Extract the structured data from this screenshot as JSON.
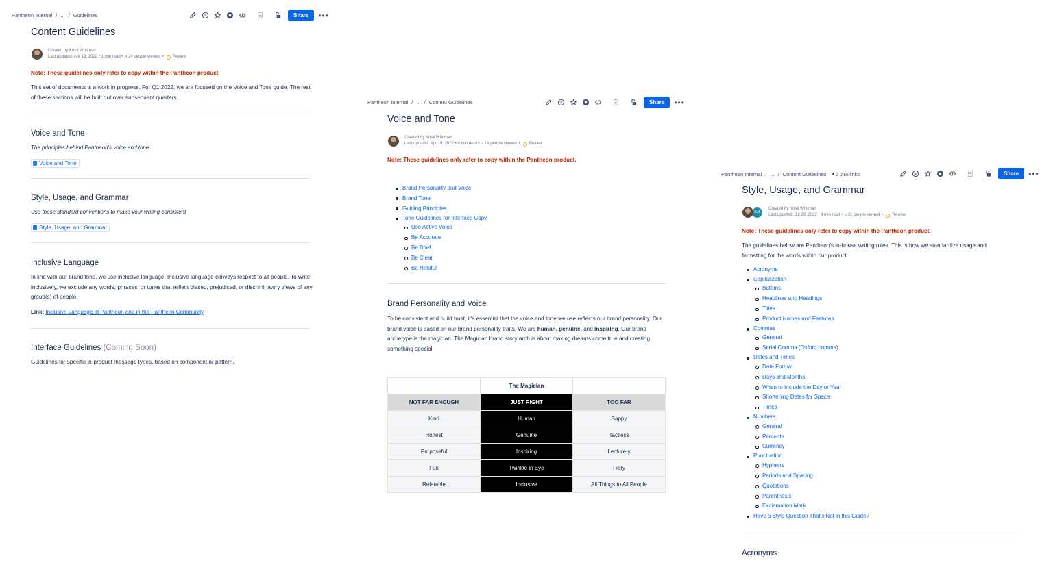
{
  "common": {
    "space": "Pantheon Internal",
    "ellipsis": "...",
    "slash": "/",
    "share": "Share",
    "dots": "•••",
    "created_prefix": "Created by",
    "author": "Kristi Whitman",
    "review": "Review",
    "note": "Note: These guidelines only refer to copy within the Pantheon product."
  },
  "panel1": {
    "crumb": "Guidelines",
    "title": "Content Guidelines",
    "meta": "Last updated: Apr 19, 2022 •  1 min read  •  ",
    "views": "24 people viewed",
    "intro": "This set of documents is a work in progress. For Q1 2022, we are focused on the Voice and Tone guide. The rest of these sections will be built out over subsequent quarters.",
    "sections": [
      {
        "heading": "Voice and Tone",
        "desc": "The principles behind Pantheon's voice and tone",
        "link": "Voice and Tone"
      },
      {
        "heading": "Style, Usage, and Grammar",
        "desc": "Use these standard conventions to make your writing consistent",
        "link": "Style, Usage, and Grammar"
      }
    ],
    "inclusive": {
      "heading": "Inclusive Language",
      "body": "In line with our brand tone, we use inclusive language. Inclusive language conveys respect to all people. To write inclusively, we exclude any words, phrases, or tones that reflect biased, prejudiced, or discriminatory views of any group(s) of people.",
      "link_label": "Link:",
      "link_text": "Inclusive Language at Pantheon and in the Pantheon Community"
    },
    "interface": {
      "heading": "Interface Guidelines",
      "soon": "(Coming Soon)",
      "body": "Guidelines for specific in-product message types, based on component or pattern."
    }
  },
  "panel2": {
    "crumb": "Content Guidelines",
    "title": "Voice and Tone",
    "meta": "Last updated: Apr 19, 2022 •  4 min read  •  ",
    "views": "19 people viewed",
    "toc": [
      "Brand Personality and Voice",
      "Brand Tone",
      "Guiding Principles",
      "Tone Guidelines for Interface Copy",
      "Use Active Voice",
      "Be Accurate",
      "Be Brief",
      "Be Clear",
      "Be Helpful"
    ],
    "section_heading": "Brand Personality and Voice",
    "body_a": "To be consistent and build trust, it's essential that the voice and tone we use reflects our brand personality. Our brand voice is based on our brand personality traits. We are ",
    "body_b1": "human, genuine,",
    "body_and": " and ",
    "body_b2": "inspiring",
    "body_c": ". Our brand archetype is the magician. The Magician brand story arch is about making dreams come true and creating something special.",
    "table": {
      "caption": "The Magician",
      "headers": [
        "NOT FAR ENOUGH",
        "JUST RIGHT",
        "TOO FAR"
      ],
      "rows": [
        [
          "Kind",
          "Human",
          "Sappy"
        ],
        [
          "Honest",
          "Genuine",
          "Tactless"
        ],
        [
          "Purposeful",
          "Inspiring",
          "Lecture-y"
        ],
        [
          "Fun",
          "Twinkle in Eye",
          "Fiery"
        ],
        [
          "Relatable",
          "Inclusive",
          "All Things to All People"
        ]
      ]
    }
  },
  "panel3": {
    "crumb": "Content Guidelines",
    "jira": "2 Jira links",
    "title": "Style, Usage, and Grammar",
    "avatar2": "KR",
    "meta": "Last updated: Jul 29, 2022 •  4 min read  •  ",
    "views": "31 people viewed",
    "intro": "The guidelines below are Pantheon's in-house writing rules. This is how we standardize usage and formatting for the words within our product.",
    "toc": [
      {
        "t": "Acronyms",
        "sub": false
      },
      {
        "t": "Capitalization",
        "sub": false
      },
      {
        "t": "Buttons",
        "sub": true
      },
      {
        "t": "Headlines and Headings",
        "sub": true
      },
      {
        "t": "Titles",
        "sub": true
      },
      {
        "t": "Product Names and Features",
        "sub": true
      },
      {
        "t": "Commas",
        "sub": false
      },
      {
        "t": "General",
        "sub": true
      },
      {
        "t": "Serial Comma (Oxford comma)",
        "sub": true
      },
      {
        "t": "Dates and Times",
        "sub": false
      },
      {
        "t": "Date Format",
        "sub": true
      },
      {
        "t": "Days and Months",
        "sub": true
      },
      {
        "t": "When to Include the Day or Year",
        "sub": true
      },
      {
        "t": "Shortening Dates for Space",
        "sub": true
      },
      {
        "t": "Times",
        "sub": true
      },
      {
        "t": "Numbers",
        "sub": false
      },
      {
        "t": "General",
        "sub": true
      },
      {
        "t": "Percents",
        "sub": true
      },
      {
        "t": "Currency",
        "sub": true
      },
      {
        "t": "Punctuation",
        "sub": false
      },
      {
        "t": "Hyphens",
        "sub": true
      },
      {
        "t": "Periods and Spacing",
        "sub": true
      },
      {
        "t": "Quotations",
        "sub": true
      },
      {
        "t": "Parenthesis",
        "sub": true
      },
      {
        "t": "Exclamation Mark",
        "sub": true
      },
      {
        "t": "Have a Style Question That's Not in this Guide?",
        "sub": false
      }
    ],
    "section_heading": "Acronyms"
  }
}
